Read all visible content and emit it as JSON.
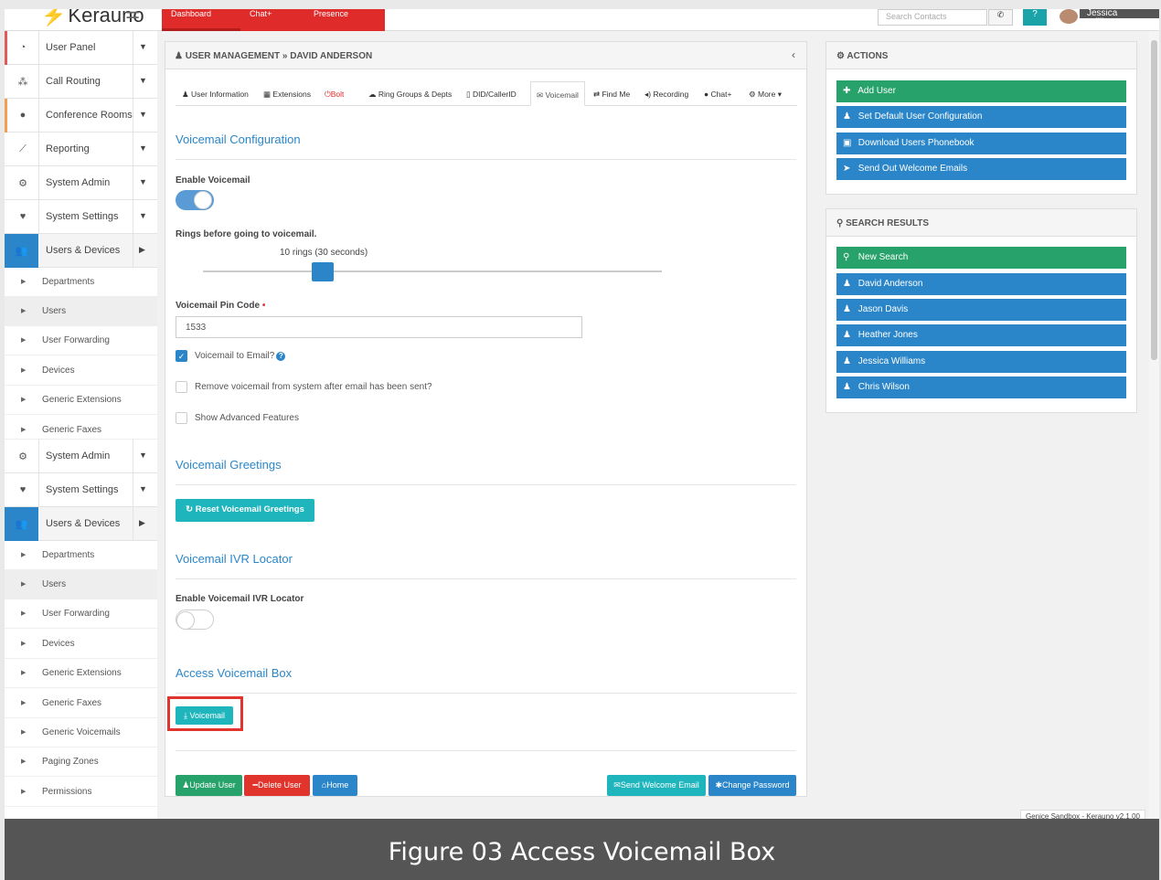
{
  "topbar": {
    "brand": "Kerauno",
    "tabs": [
      "Dashboard",
      "Chat+",
      "Presence"
    ],
    "search_placeholder": "Search Contacts",
    "help": "?",
    "user": "Jessica Williams"
  },
  "sidebar": {
    "groups1": [
      {
        "label": "User Panel",
        "icon": "tachometer-icon"
      },
      {
        "label": "Call Routing",
        "icon": "sitemap-icon"
      },
      {
        "label": "Conference Rooms",
        "icon": "comments-icon"
      },
      {
        "label": "Reporting",
        "icon": "line-chart-icon"
      },
      {
        "label": "System Admin",
        "icon": "cogs-icon"
      },
      {
        "label": "System Settings",
        "icon": "heartbeat-icon"
      },
      {
        "label": "Users & Devices",
        "icon": "users-icon"
      }
    ],
    "subs1": [
      "Departments",
      "Users",
      "User Forwarding",
      "Devices",
      "Generic Extensions",
      "Generic Faxes"
    ],
    "groups2": [
      {
        "label": "System Admin"
      },
      {
        "label": "System Settings"
      },
      {
        "label": "Users & Devices"
      }
    ],
    "subs2": [
      "Departments",
      "Users",
      "User Forwarding",
      "Devices",
      "Generic Extensions",
      "Generic Faxes",
      "Generic Voicemails",
      "Paging Zones",
      "Permissions"
    ]
  },
  "main": {
    "header": "USER MANAGEMENT » DAVID ANDERSON",
    "tabs": [
      "User Information",
      "Extensions",
      "Bolt",
      "Ring Groups & Depts",
      "DID/CallerID",
      "Voicemail",
      "Find Me",
      "Recording",
      "Chat+",
      "More"
    ],
    "voicemail_config_title": "Voicemail Configuration",
    "enable_voicemail_label": "Enable Voicemail",
    "enable_voicemail": true,
    "rings_label": "Rings before going to voicemail.",
    "rings_value": "10 rings (30 seconds)",
    "pin_label": "Voicemail Pin Code",
    "pin_required": "•",
    "pin_value": "1533",
    "vm_to_email_label": "Voicemail to Email?",
    "vm_to_email": true,
    "remove_label": "Remove voicemail from system after email has been sent?",
    "remove": false,
    "advanced_label": "Show Advanced Features",
    "advanced": false,
    "greetings_title": "Voicemail Greetings",
    "reset_greetings_btn": "Reset Voicemail Greetings",
    "ivr_title": "Voicemail IVR Locator",
    "ivr_label": "Enable Voicemail IVR Locator",
    "ivr_enabled": false,
    "access_title": "Access Voicemail Box",
    "voicemail_btn": "Voicemail",
    "update_btn": "Update User",
    "delete_btn": "Delete User",
    "home_btn": "Home",
    "welcome_btn": "Send Welcome Email",
    "password_btn": "Change Password"
  },
  "actions": {
    "title": "ACTIONS",
    "buttons": [
      "Add User",
      "Set Default User Configuration",
      "Download Users Phonebook",
      "Send Out Welcome Emails"
    ]
  },
  "search_results": {
    "title": "SEARCH RESULTS",
    "new_search": "New Search",
    "users": [
      "David Anderson",
      "Jason Davis",
      "Heather Jones",
      "Jessica Williams",
      "Chris Wilson"
    ]
  },
  "footer": {
    "version": "Genice Sandbox - Kerauno v2.1.00"
  },
  "caption": "Figure 03 Access Voicemail Box",
  "colors": {
    "accent_blue": "#2a86c9",
    "teal": "#1fb5bd",
    "green": "#27a26a",
    "red": "#e0342d"
  }
}
